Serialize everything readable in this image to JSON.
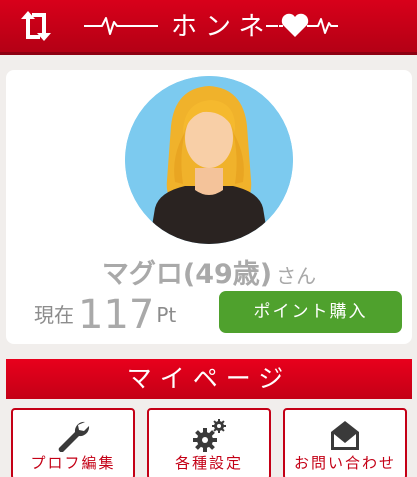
{
  "header": {
    "refresh_icon": "swap-arrows-icon",
    "logo_text": "ホンネ",
    "logo_icons": [
      "heartbeat-line",
      "heart-icon"
    ],
    "color": "#c8001a"
  },
  "profile": {
    "avatar_icon": "woman-avatar",
    "name": "マグロ(49歳)",
    "honorific": "さん",
    "points_prefix": "現在",
    "points_value": "117",
    "points_unit": "Pt",
    "buy_button_label": "ポイント購入",
    "buy_button_color": "#4fa12d"
  },
  "mypage": {
    "title": "マイページ",
    "tiles": [
      {
        "label": "プロフ編集",
        "icon": "wrench-icon"
      },
      {
        "label": "各種設定",
        "icon": "gears-icon"
      },
      {
        "label": "お問い合わせ",
        "icon": "envelope-upload-icon"
      }
    ]
  }
}
